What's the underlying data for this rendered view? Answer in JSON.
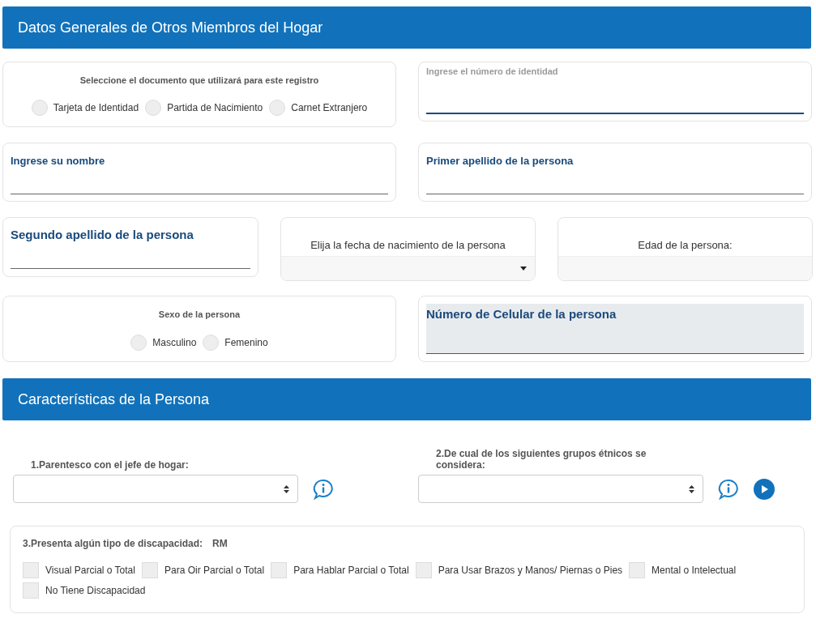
{
  "general_header": {
    "title": "Datos Generales de Otros Miembros del Hogar"
  },
  "document_type": {
    "label": "Seleccione el documento que utilizará para este registro",
    "options": [
      {
        "label": "Tarjeta de Identidad",
        "selected": false
      },
      {
        "label": "Partida de Nacimiento",
        "selected": false
      },
      {
        "label": "Carnet Extranjero",
        "selected": false
      }
    ]
  },
  "identity_number": {
    "placeholder": "Ingrese el número de identidad"
  },
  "first_name": {
    "label": "Ingrese su nombre"
  },
  "first_surname": {
    "label": "Primer apellido de la persona"
  },
  "second_surname": {
    "label": "Segundo apellido de la persona"
  },
  "birth_date": {
    "label": "Elija la fecha de nacimiento de la persona"
  },
  "age": {
    "label": "Edad de la persona:"
  },
  "sex": {
    "label": "Sexo de la persona",
    "options": [
      {
        "label": "Masculino",
        "selected": false
      },
      {
        "label": "Femenino",
        "selected": false
      }
    ]
  },
  "cellphone": {
    "label": "Número de Celular de la persona"
  },
  "characteristics_header": {
    "title": "Características de la Persona"
  },
  "relationship": {
    "label": "1.Parentesco con el jefe de hogar:"
  },
  "ethnic_group": {
    "label": "2.De cual de los siguientes grupos étnicos se considera:"
  },
  "disability": {
    "label": "3.Presenta algún tipo de discapacidad:",
    "code": "RM",
    "options": [
      {
        "label": "Visual Parcial o Total",
        "checked": false
      },
      {
        "label": "Para Oir Parcial o Total",
        "checked": false
      },
      {
        "label": "Para Hablar Parcial o Total",
        "checked": false
      },
      {
        "label": "Para Usar Brazos y Manos/ Piernas o Pies",
        "checked": false
      },
      {
        "label": "Mental o Intelectual",
        "checked": false
      },
      {
        "label": "No Tiene Discapacidad",
        "checked": false
      }
    ]
  }
}
